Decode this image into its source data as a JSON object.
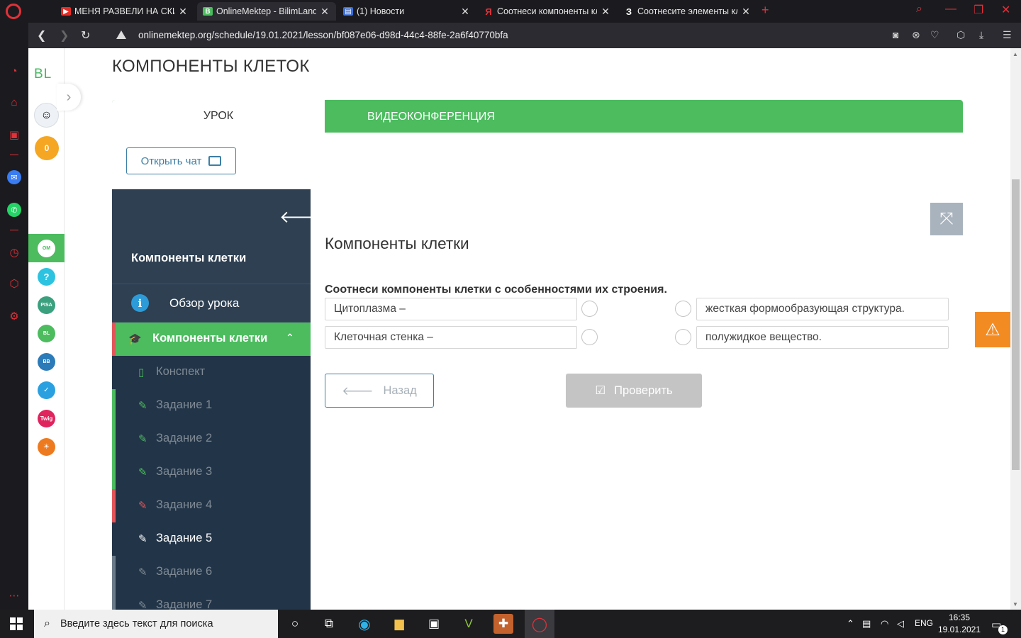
{
  "browser": {
    "tabs": [
      {
        "title": "МЕНЯ РАЗВЕЛИ НА СКИНЫ",
        "icon": "youtube-icon"
      },
      {
        "title": "OnlineMektep - BilimLand",
        "icon": "bilimland-icon",
        "active": true
      },
      {
        "title": "(1) Новости",
        "icon": "news-icon"
      },
      {
        "title": "Соотнеси компоненты кле",
        "icon": "yandex-icon"
      },
      {
        "title": "Соотнесите элементы кле",
        "icon": "z-icon"
      }
    ],
    "url": "onlinemektep.org/schedule/19.01.2021/lesson/bf087e06-d98d-44c4-88fe-2a6f40770bfa"
  },
  "rail": {
    "logo": "BL",
    "coins": "0"
  },
  "page": {
    "title": "КОМПОНЕНТЫ КЛЕТОК",
    "tabs": {
      "lesson": "УРОК",
      "video": "ВИДЕОКОНФЕРЕНЦИЯ"
    },
    "chat_button": "Открыть чат"
  },
  "nav": {
    "header": "Компоненты клетки",
    "overview": "Обзор урока",
    "current": "Компоненты клетки",
    "items": [
      {
        "label": "Конспект",
        "marker": "#223447",
        "icon_color": "#4cbc5f"
      },
      {
        "label": "Задание 1",
        "marker": "#4cbc5f",
        "icon_color": "#4cbc5f"
      },
      {
        "label": "Задание 2",
        "marker": "#4cbc5f",
        "icon_color": "#4cbc5f"
      },
      {
        "label": "Задание 3",
        "marker": "#4cbc5f",
        "icon_color": "#4cbc5f"
      },
      {
        "label": "Задание 4",
        "marker": "#e2555a",
        "icon_color": "#e2555a"
      },
      {
        "label": "Задание 5",
        "marker": "#223447",
        "icon_color": "#ffffff",
        "active": true
      },
      {
        "label": "Задание 6",
        "marker": "#6b7a88",
        "icon_color": "#7f8a95"
      },
      {
        "label": "Задание 7",
        "marker": "#6b7a88",
        "icon_color": "#7f8a95"
      }
    ]
  },
  "task": {
    "heading": "Компоненты клетки",
    "question": "Соотнеси компоненты клетки с особенностями их строения.",
    "left": [
      "Цитоплазма –",
      "Клеточная стенка –"
    ],
    "right": [
      "жесткая формообразующая структура.",
      "полужидкое вещество."
    ],
    "back_button": "Назад",
    "check_button": "Проверить"
  },
  "taskbar": {
    "search_placeholder": "Введите здесь текст для поиска",
    "lang": "ENG",
    "time": "16:35",
    "date": "19.01.2021",
    "notifications": "1"
  },
  "colors": {
    "accent": "#4cbc5f",
    "nav_bg": "#223447",
    "opera_red": "#e0323a",
    "link_blue": "#3d7fa5",
    "warning": "#f38b23"
  }
}
